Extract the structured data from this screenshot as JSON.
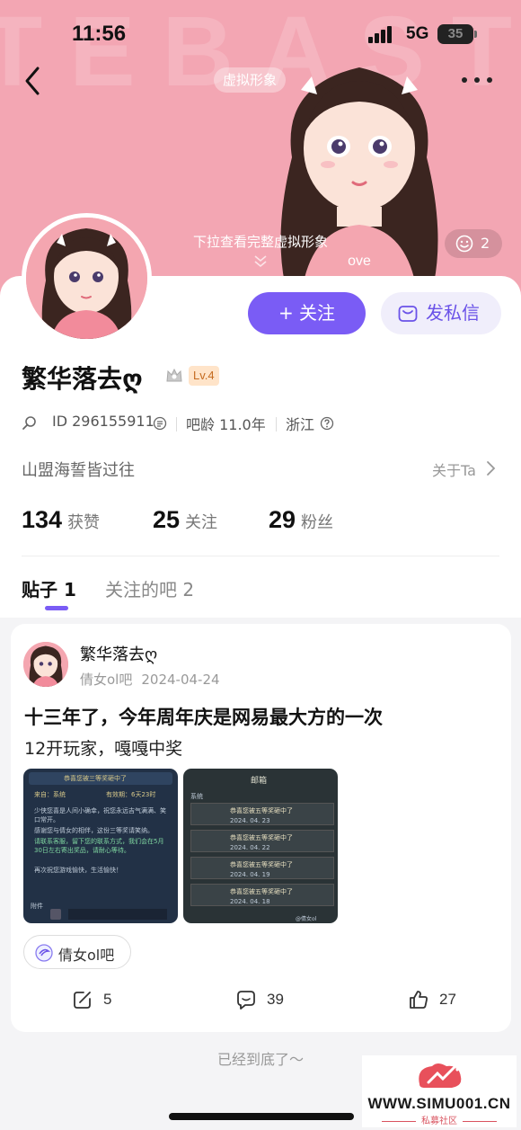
{
  "status_bar": {
    "time": "11:56",
    "network": "5G",
    "battery": "35"
  },
  "header": {
    "avatar_tag": "虚拟形象",
    "pulldown_hint": "下拉查看完整虚拟形象",
    "like_count": "2",
    "background_letters": "TEBAST ATIEA"
  },
  "profile": {
    "follow_label": "+ 关注",
    "message_label": "发私信",
    "username": "繁华落去ღ",
    "level": "Lv.4",
    "id_label": "ID 296155911",
    "bar_age": "吧龄 11.0年",
    "location": "浙江",
    "bio": "山盟海誓皆过往",
    "about": "关于Ta"
  },
  "stats": {
    "likes": "134",
    "likes_label": "获赞",
    "following": "25",
    "following_label": "关注",
    "fans": "29",
    "fans_label": "粉丝"
  },
  "tabs": {
    "posts": "贴子 1",
    "followed_bars": "关注的吧 2"
  },
  "post": {
    "author": "繁华落去ღ",
    "bar": "倩女ol吧",
    "date": "2024-04-24",
    "title": "十三年了，今年周年庆是网易最大方的一次",
    "body": "12开玩家，嘎嘎中奖",
    "bar_chip": "倩女ol吧",
    "reposts": "5",
    "comments": "39",
    "likes": "27",
    "image1": {
      "title": "恭喜您被三等奖砸中了",
      "from": "来自：系统",
      "validity": "有效期：6天23时",
      "lines": [
        "少侠您喜是人间小确幸，祝您永远吉气满满、笑口常开。",
        "感谢您与倩女的相伴，这份三等奖请笑纳。",
        "请联系客服，留下您的联系方式，我们会在5月30日左右寄出奖品，请耐心等待。",
        "再次祝您游戏愉快，生活愉快！"
      ],
      "attachment": "附件"
    },
    "image2": {
      "header": "邮箱",
      "sender": "系统",
      "items": [
        {
          "text": "恭喜您被五等奖砸中了",
          "date": "2024. 04. 23"
        },
        {
          "text": "恭喜您被五等奖砸中了",
          "date": "2024. 04. 22"
        },
        {
          "text": "恭喜您被五等奖砸中了",
          "date": "2024. 04. 19"
        },
        {
          "text": "恭喜您被五等奖砸中了",
          "date": "2024. 04. 18"
        }
      ],
      "watermark": "@倩女ol"
    }
  },
  "footer": {
    "end_text": "已经到底了～"
  },
  "watermark": {
    "url": "WWW.SIMU001.CN",
    "sub": "私募社区"
  },
  "colors": {
    "header_pink": "#f3a6b3",
    "accent_purple": "#7a5cf5",
    "message_bg": "#f0eefb"
  }
}
